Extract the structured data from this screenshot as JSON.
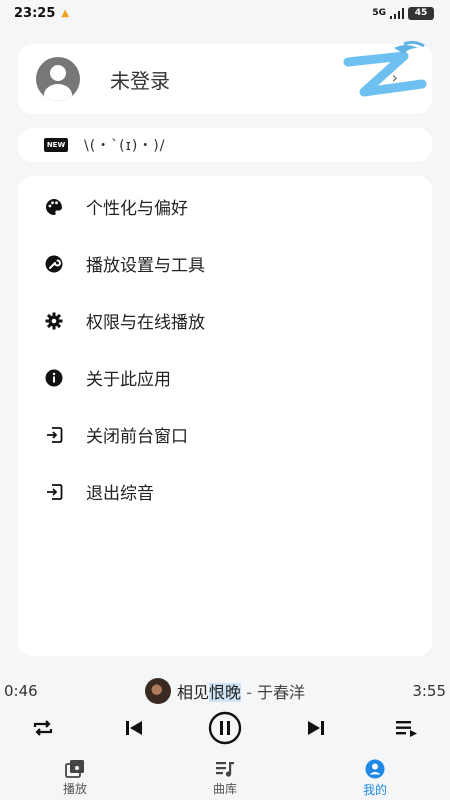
{
  "status_bar": {
    "time": "23:25",
    "network": "5G",
    "battery": "45"
  },
  "account": {
    "name": "未登录"
  },
  "announcement": {
    "badge": "NEW",
    "text": "\\(・`(ɪ)・)/"
  },
  "menu": {
    "items": [
      {
        "label": "个性化与偏好",
        "icon": "palette-icon"
      },
      {
        "label": "播放设置与工具",
        "icon": "wrench-icon"
      },
      {
        "label": "权限与在线播放",
        "icon": "gear-icon"
      },
      {
        "label": "关于此应用",
        "icon": "info-icon"
      },
      {
        "label": "关闭前台窗口",
        "icon": "exit-icon"
      },
      {
        "label": "退出综音",
        "icon": "exit-icon"
      }
    ]
  },
  "player": {
    "elapsed": "0:46",
    "duration": "3:55",
    "song_a": "相见",
    "song_b": "恨晚",
    "separator": " - ",
    "artist": "于春洋"
  },
  "nav": {
    "items": [
      {
        "label": "播放",
        "icon": "album-icon"
      },
      {
        "label": "曲库",
        "icon": "library-icon"
      },
      {
        "label": "我的",
        "icon": "account-icon"
      }
    ],
    "active_color": "#1e88e5"
  }
}
